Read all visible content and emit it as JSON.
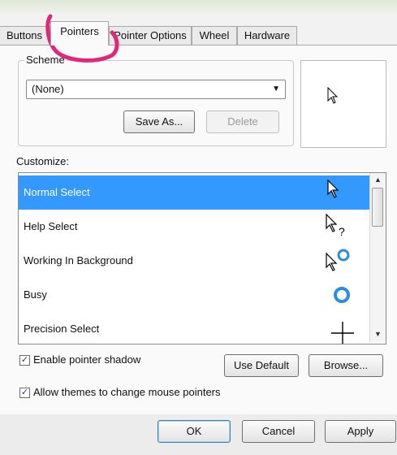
{
  "tabs": [
    {
      "label": "Buttons"
    },
    {
      "label": "Pointers"
    },
    {
      "label": "Pointer Options"
    },
    {
      "label": "Wheel"
    },
    {
      "label": "Hardware"
    }
  ],
  "scheme": {
    "group_label": "Scheme",
    "selected": "(None)",
    "save_as_label": "Save As...",
    "delete_label": "Delete"
  },
  "customize": {
    "label": "Customize:",
    "items": [
      {
        "label": "Normal Select",
        "icon": "arrow-cursor-icon",
        "selected": true
      },
      {
        "label": "Help Select",
        "icon": "help-cursor-icon"
      },
      {
        "label": "Working In Background",
        "icon": "working-cursor-icon"
      },
      {
        "label": "Busy",
        "icon": "busy-cursor-icon"
      },
      {
        "label": "Precision Select",
        "icon": "crosshair-cursor-icon"
      }
    ]
  },
  "options": {
    "shadow_label": "Enable pointer shadow",
    "shadow_checked": true,
    "themes_label": "Allow themes to change mouse pointers",
    "themes_checked": true
  },
  "buttons": {
    "use_default": "Use Default",
    "browse": "Browse...",
    "ok": "OK",
    "cancel": "Cancel",
    "apply": "Apply"
  },
  "colors": {
    "selection": "#3399ff",
    "busy_ring": "#2b8de0",
    "annotation": "#e0287a"
  }
}
